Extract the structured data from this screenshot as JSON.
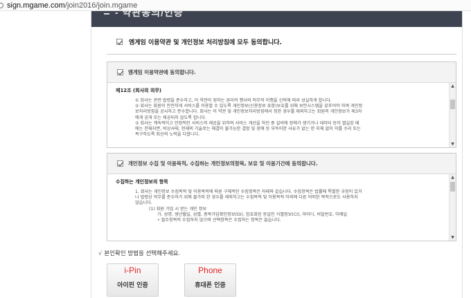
{
  "address_bar": {
    "domain": "sign.mgame.com",
    "path": "/join2016/join.mgame"
  },
  "header": {
    "title": "- 약관동의/인증"
  },
  "agree_all": {
    "label": "엠게임 이용약관 및 개인정보 처리방침에 모두 동의합니다.",
    "checked": true
  },
  "terms_box": {
    "header_label": "엠게임 이용약관에 동의합니다.",
    "checked": true,
    "section_title": "제12조 (회사의 의무)",
    "lines": [
      "① 회사는 관련 법령을 준수하고, 이 약관이 정하는 권리의 행사와 의무의 이행을 신의에 따라 성실하게 합니다.",
      "② 회사는 회원이 안전하게 서비스를 이용할 수 있도록 개인정보(신용정보 포함)보호를 위해 보안시스템을 갖추어야 하며 개인정",
      "보처리방침을 공시하고 준수합니다. 회사는 이 약관 및 개인정보처리방침에서 정한 경우를 제외하고는 회원의 개인정보가 제3자",
      "에게 공개 또는 제공되지 않도록 합니다.",
      "③ 회사는 계속적이고 안정적인 서비스의 제공을 위하여 서비스 개선을 하던 중 설비에 장애가 생기거나 데이터 등이 멸실된 때",
      "에는 천재지변, 비상사태, 현재의 기술로는 해결이 불가능한 결함 및 장애 등 부득이한 사유가 없는 한 지체 없이 이를 수리 또는",
      "복구하도록 최선의 노력을 다합니다."
    ]
  },
  "privacy_box": {
    "header_label": "개인정보 수집 및 이용목적, 수집하는 개인정보의항목, 보유 및 이용기간에 동의합니다.",
    "checked": true,
    "section_title": "수집하는 개인정보의 항목",
    "lines": [
      "1. 회사는 개인정보 수집목적 및 이용목적에 따른 구체적인 수집항목은 아래와 같습니다. 수집항목은 법률에 특별한 규정이 있거",
      "나 법령상 의무를 준수하기 위해 불가피 한 경우를 제외하고는 수집목적 및 이용목적 이외에 다른 어떠한 목적으로도 사용하지",
      "않습니다."
    ],
    "sub_item": "(1) 회원 가입 시 받는 개인 정보",
    "sub_lines": [
      "가. 성명, 생년월일, 성별, 중복가입확인정보(DI), 암호화된 동일인 식별정보(CI), 아이디, 비밀번호, 이메일",
      "• 필수항목의 수집하지 않으며 선택항목은 수집하는 항목은 없습니다."
    ]
  },
  "verification": {
    "prompt_mark": "√",
    "prompt": "본인확인 방법을 선택해주세요.",
    "ipin": {
      "tag": "i-Pin",
      "label": "아이핀 인증"
    },
    "phone": {
      "tag": "Phone",
      "label": "휴대폰 인증"
    },
    "tag_color": "#e32222"
  }
}
